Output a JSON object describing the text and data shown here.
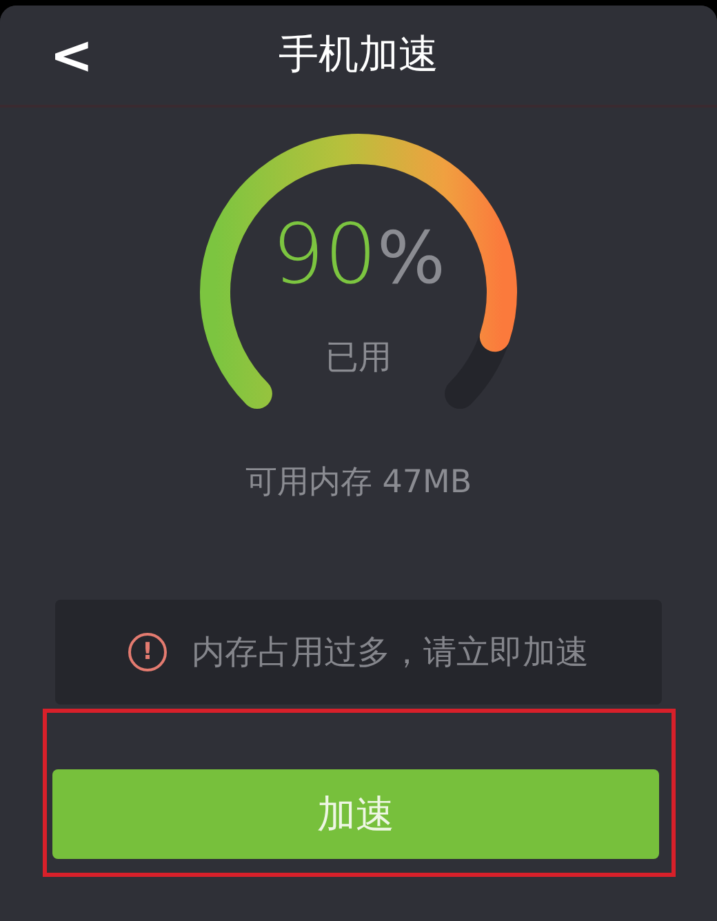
{
  "header": {
    "back": "<",
    "title": "手机加速"
  },
  "gauge": {
    "value": "90",
    "unit": "%",
    "label": "已用"
  },
  "available": "可用内存 47MB",
  "warning": {
    "icon": "!",
    "text": "内存占用过多，请立即加速"
  },
  "button": {
    "label": "加速",
    "highlighted": true
  }
}
